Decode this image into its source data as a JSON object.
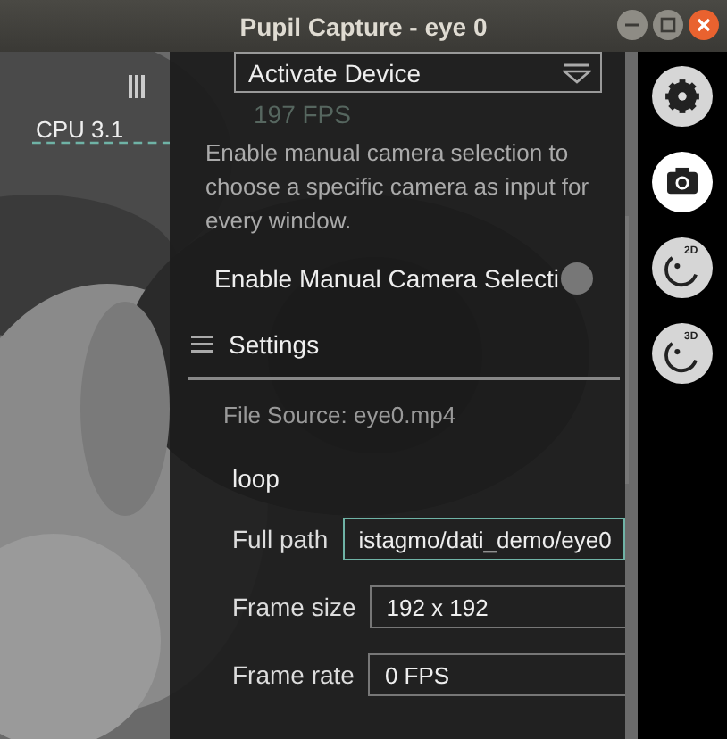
{
  "window": {
    "title": "Pupil Capture - eye 0",
    "buttons": [
      {
        "kind": "minimize"
      },
      {
        "kind": "maximize"
      },
      {
        "kind": "close"
      }
    ]
  },
  "overlay": {
    "cpu": "CPU 3.1",
    "fps": "197 FPS"
  },
  "device_selector": {
    "value": "Activate Device"
  },
  "description": "Enable manual camera selection to choose a specific camera as input for every window.",
  "manual_selection": {
    "label": "Enable Manual Camera Selecti",
    "on": false
  },
  "settings": {
    "title": "Settings",
    "file_source": "File Source: eye0.mp4",
    "loop": "loop",
    "fields": [
      {
        "label": "Full path",
        "value": "istagmo/dati_demo/eye0",
        "focused": true
      },
      {
        "label": "Frame size",
        "value": "192 x 192",
        "focused": false
      },
      {
        "label": "Frame rate",
        "value": "0 FPS",
        "focused": false
      }
    ]
  },
  "sidebar": [
    {
      "kind": "gear",
      "selected": false
    },
    {
      "kind": "camera",
      "selected": true
    },
    {
      "kind": "eye",
      "badge": "2D",
      "selected": false
    },
    {
      "kind": "eye",
      "badge": "3D",
      "selected": false
    }
  ]
}
